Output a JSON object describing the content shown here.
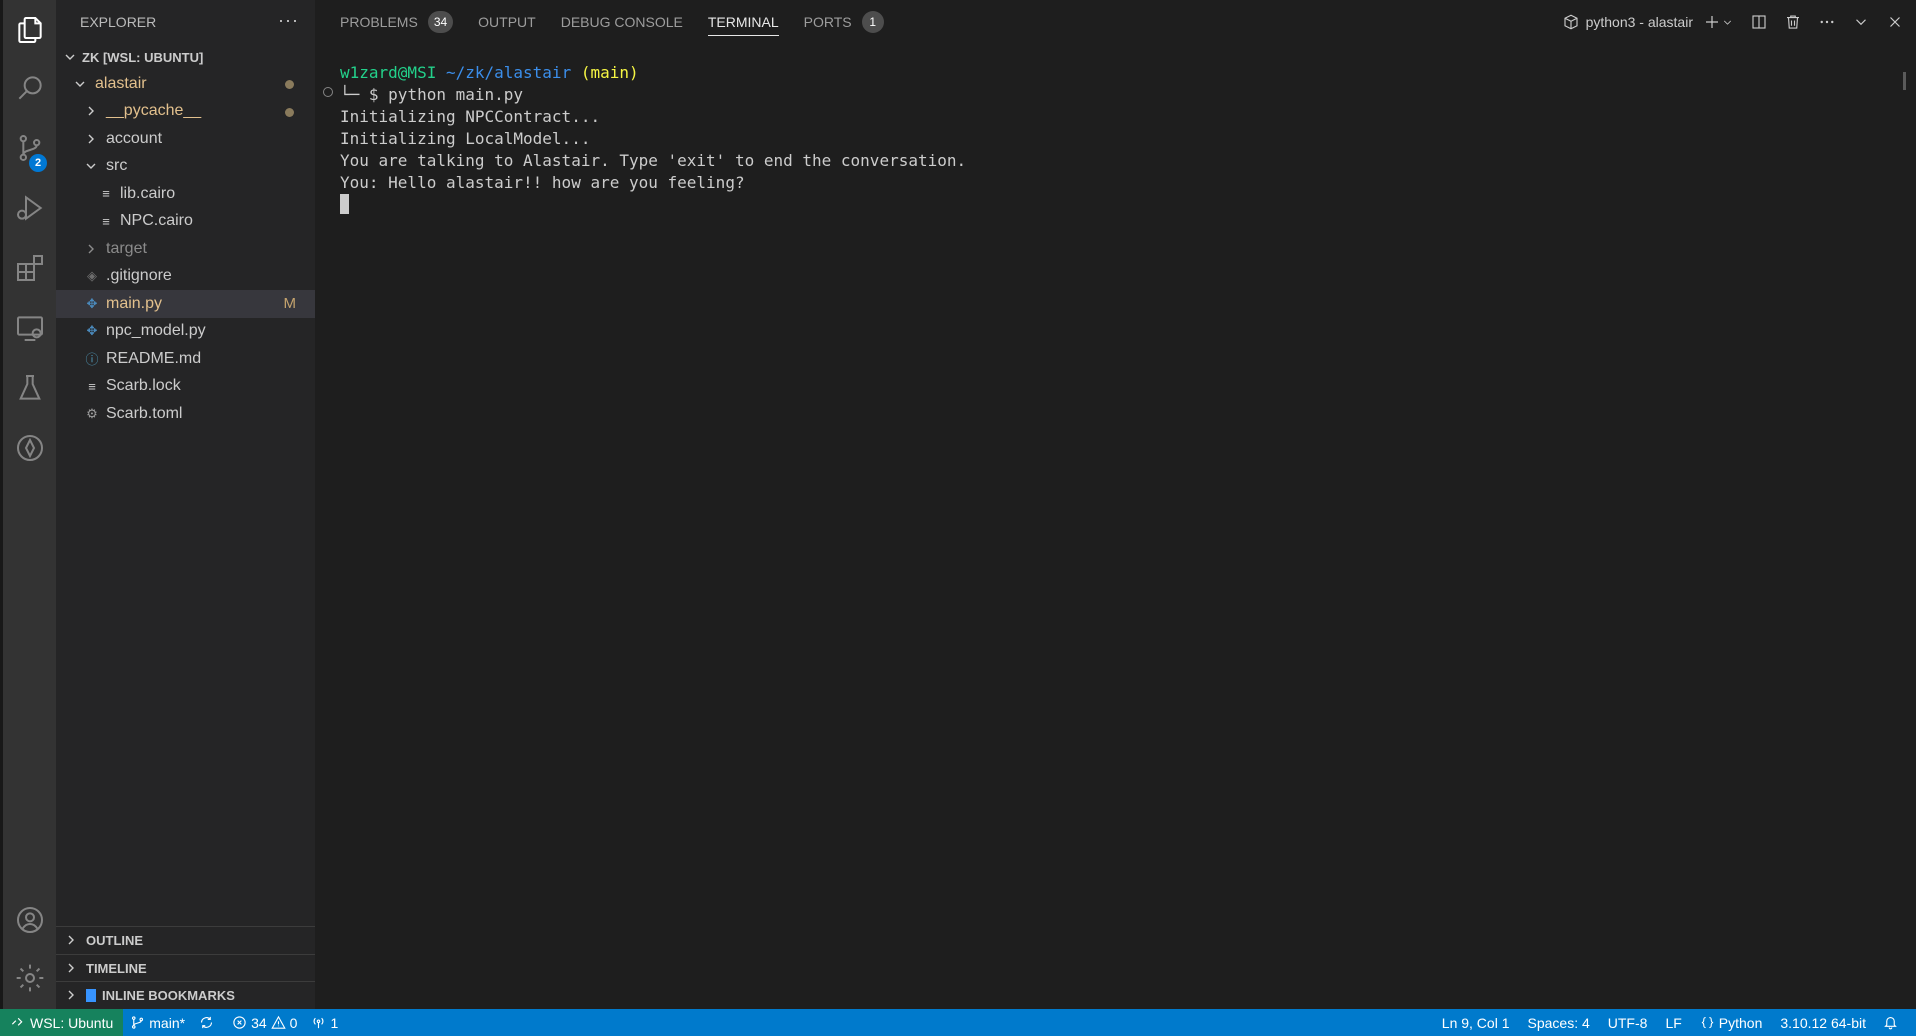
{
  "activity_bar": {
    "icons": [
      "files-icon",
      "search-icon",
      "source-control-icon",
      "run-debug-icon",
      "extensions-icon",
      "remote-explorer-icon",
      "testing-icon",
      "cairo-icon",
      "account-icon",
      "settings-gear-icon"
    ],
    "scm_badge": "2"
  },
  "sidebar": {
    "title": "EXPLORER",
    "more": "···",
    "workspace": "ZK [WSL: UBUNTU]",
    "tree": [
      {
        "label": "alastair"
      },
      {
        "label": "__pycache__"
      },
      {
        "label": "account"
      },
      {
        "label": "src"
      },
      {
        "label": "lib.cairo"
      },
      {
        "label": "NPC.cairo"
      },
      {
        "label": "target"
      },
      {
        "label": ".gitignore"
      },
      {
        "label": "main.py",
        "badge": "M"
      },
      {
        "label": "npc_model.py"
      },
      {
        "label": "README.md"
      },
      {
        "label": "Scarb.lock"
      },
      {
        "label": "Scarb.toml"
      }
    ],
    "sections": [
      "OUTLINE",
      "TIMELINE",
      "INLINE BOOKMARKS"
    ]
  },
  "panel": {
    "tabs": [
      {
        "label": "PROBLEMS",
        "count": "34"
      },
      {
        "label": "OUTPUT"
      },
      {
        "label": "DEBUG CONSOLE"
      },
      {
        "label": "TERMINAL"
      },
      {
        "label": "PORTS",
        "count": "1"
      }
    ],
    "terminal_name": "python3 - alastair"
  },
  "terminal": {
    "prompt_user": "w1zard@MSI",
    "prompt_path": "~/zk/alastair",
    "prompt_branch": "(main)",
    "prompt_symbol": "└─ $",
    "command": "python main.py",
    "lines": [
      "Initializing NPCContract...",
      "Initializing LocalModel...",
      "You are talking to Alastair. Type 'exit' to end the conversation.",
      "You: Hello alastair!! how are you feeling?"
    ]
  },
  "statusbar": {
    "remote": "WSL: Ubuntu",
    "branch": "main*",
    "errors": "34",
    "warnings": "0",
    "ports": "1",
    "position": "Ln 9, Col 1",
    "spaces": "Spaces: 4",
    "encoding": "UTF-8",
    "eol": "LF",
    "language": "Python",
    "interpreter": "3.10.12 64-bit"
  },
  "colors": {
    "statusbar": "#007acc",
    "remote": "#16825d",
    "accent": "#0078d4"
  }
}
